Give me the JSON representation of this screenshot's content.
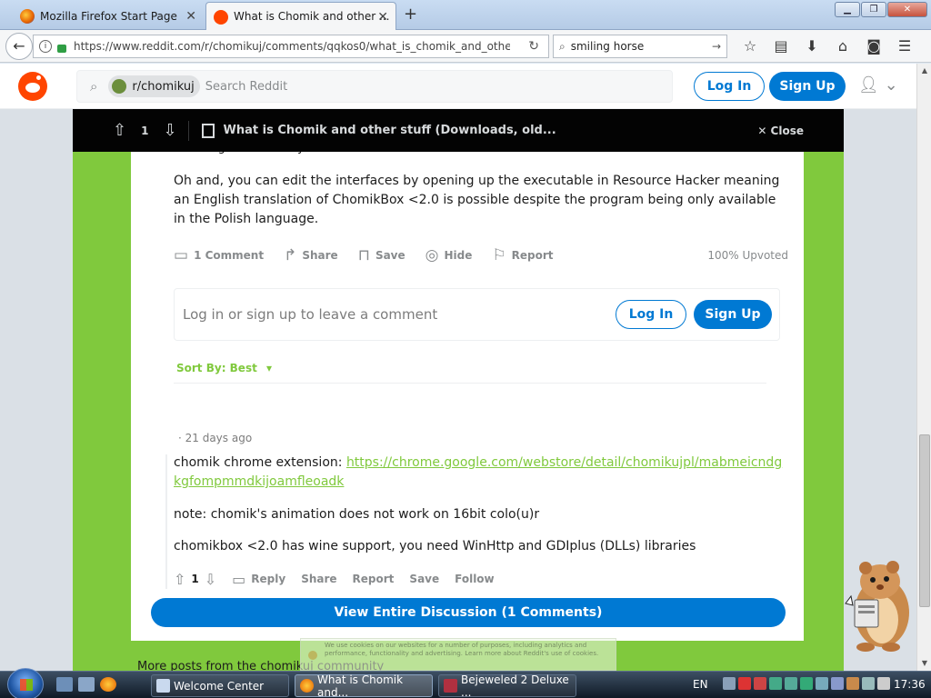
{
  "browser": {
    "tabs": [
      {
        "title": "Mozilla Firefox Start Page",
        "active": false
      },
      {
        "title": "What is Chomik and other ...",
        "active": true
      }
    ],
    "new_tab_symbol": "+",
    "url": "https://www.reddit.com/r/chomikuj/comments/qqkos0/what_is_chomik_and_other_s",
    "search_value": "smiling horse",
    "toolbar_icons": [
      "bookmark-star-icon",
      "reading-list-icon",
      "downloads-icon",
      "home-icon",
      "pocket-icon",
      "menu-icon"
    ]
  },
  "reddit_header": {
    "subreddit_chip": "r/chomikuj",
    "search_placeholder": "Search Reddit",
    "login_label": "Log In",
    "signup_label": "Sign Up"
  },
  "post_bar": {
    "score": "1",
    "title": "What is Chomik and other stuff (Downloads, old...",
    "close_label": "Close"
  },
  "post": {
    "clipped_line": "resulting into an army of Chomiks",
    "body": "Oh and, you can edit the interfaces by opening up the executable in Resource Hacker meaning an English translation of ChomikBox <2.0 is possible despite the program being only available in the Polish language.",
    "actions": {
      "comments": "1 Comment",
      "share": "Share",
      "save": "Save",
      "hide": "Hide",
      "report": "Report"
    },
    "upvoted": "100% Upvoted"
  },
  "comment_prompt": {
    "text": "Log in or sign up to leave a comment",
    "login_label": "Log In",
    "signup_label": "Sign Up"
  },
  "sort": {
    "label": "Sort By: Best"
  },
  "comment": {
    "time": "· 21 days ago",
    "line1_prefix": "chomik chrome extension: ",
    "line1_link": "https://chrome.google.com/webstore/detail/chomikujpl/mabmeicndgkgfompmmdkijoamfleoadk",
    "line2": "note: chomik's animation does not work on 16bit colo(u)r",
    "line3": "chomikbox <2.0 has wine support, you need WinHttp and GDIplus (DLLs) libraries",
    "score": "1",
    "actions": {
      "reply": "Reply",
      "share": "Share",
      "report": "Report",
      "save": "Save",
      "follow": "Follow"
    }
  },
  "view_all_label": "View Entire Discussion (1 Comments)",
  "more_posts_label": "More posts from the chomikuj community",
  "cookie_text": "We use cookies on our websites for a number of purposes, including analytics and performance, functionality and advertising. Learn more about Reddit's use of cookies.",
  "taskbar": {
    "tasks": [
      {
        "label": "Welcome Center",
        "active": false
      },
      {
        "label": "What is Chomik and...",
        "active": true
      },
      {
        "label": "Bejeweled 2 Deluxe ...",
        "active": false
      }
    ],
    "language": "EN",
    "clock": "17:36"
  },
  "colors": {
    "reddit_blue": "#0079d3",
    "subreddit_green": "#80c93d",
    "reddit_orange": "#ff4500"
  }
}
